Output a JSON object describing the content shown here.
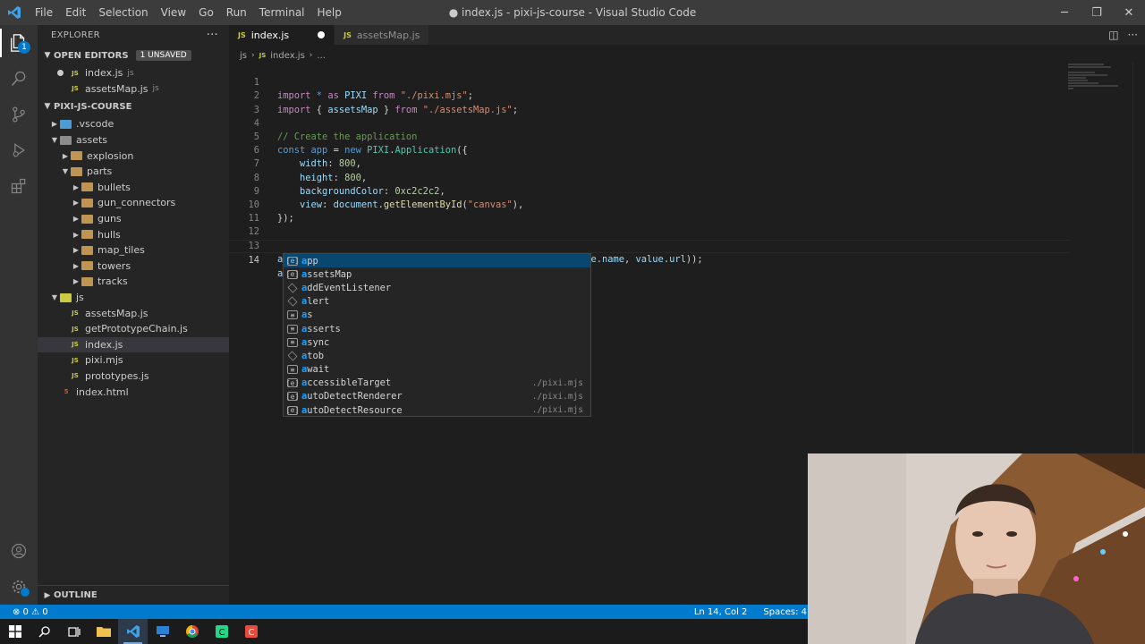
{
  "window": {
    "title": "● index.js - pixi-js-course - Visual Studio Code",
    "menu": [
      "File",
      "Edit",
      "Selection",
      "View",
      "Go",
      "Run",
      "Terminal",
      "Help"
    ]
  },
  "explorer": {
    "header": "EXPLORER",
    "open_editors": {
      "label": "OPEN EDITORS",
      "badge": "1 UNSAVED",
      "files": [
        {
          "name": "index.js",
          "desc": "js"
        },
        {
          "name": "assetsMap.js",
          "desc": "js"
        }
      ]
    },
    "project": {
      "label": "PIXI-JS-COURSE",
      "tree": [
        {
          "name": ".vscode"
        },
        {
          "name": "assets"
        },
        {
          "name": "explosion"
        },
        {
          "name": "parts"
        },
        {
          "name": "bullets"
        },
        {
          "name": "gun_connectors"
        },
        {
          "name": "guns"
        },
        {
          "name": "hulls"
        },
        {
          "name": "map_tiles"
        },
        {
          "name": "towers"
        },
        {
          "name": "tracks"
        },
        {
          "name": "js"
        },
        {
          "name": "assetsMap.js"
        },
        {
          "name": "getPrototypeChain.js"
        },
        {
          "name": "index.js"
        },
        {
          "name": "pixi.mjs"
        },
        {
          "name": "prototypes.js"
        },
        {
          "name": "index.html"
        }
      ]
    },
    "outline": "OUTLINE"
  },
  "tabs": [
    {
      "label": "index.js"
    },
    {
      "label": "assetsMap.js"
    }
  ],
  "breadcrumb": [
    "js",
    "index.js",
    "..."
  ],
  "editor": {
    "line_numbers": [
      "1",
      "2",
      "3",
      "4",
      "5",
      "6",
      "7",
      "8",
      "9",
      "10",
      "11",
      "12",
      "13",
      "14"
    ],
    "lines": {
      "l1": {
        "a": "import",
        "b": " * ",
        "c": "as",
        "d": " PIXI ",
        "e": "from",
        "f": " ",
        "g": "\"./pixi.mjs\"",
        "h": ";"
      },
      "l2": {
        "a": "import",
        "b": " { ",
        "c": "assetsMap",
        "d": " } ",
        "e": "from",
        "f": " ",
        "g": "\"./assetsMap.js\"",
        "h": ";"
      },
      "l4": "// Create the application",
      "l5": {
        "a": "const",
        "b": " ",
        "c": "app",
        "d": " = ",
        "e": "new",
        "f": " ",
        "g": "PIXI",
        "h": ".",
        "i": "Application",
        "j": "({"
      },
      "l6": {
        "k": "width",
        "s": ": ",
        "v": "800",
        "e": ","
      },
      "l7": {
        "k": "height",
        "s": ": ",
        "v": "800",
        "e": ","
      },
      "l8": {
        "k": "backgroundColor",
        "s": ": ",
        "v": "0xc2c2c2",
        "e": ","
      },
      "l9": {
        "k": "view",
        "s": ": ",
        "o": "document",
        "d": ".",
        "f": "getElementById",
        "p": "(",
        "str": "\"canvas\"",
        "e": "),"
      },
      "l10": "});",
      "l13": {
        "a": "assetsMap",
        "b": ".",
        "c": "sprites",
        "d": ".",
        "e": "forEach",
        "f": "((",
        "g": "value",
        "h": ") ",
        "i": "=>",
        "j": " ",
        "k": "app",
        "l": ".",
        "m": "loader",
        "n": ".",
        "o": "add",
        "p": "(",
        "q": "value",
        "r": ".",
        "s": "name",
        "t": ", ",
        "u": "value",
        "v": ".",
        "w": "url",
        "x": "));"
      },
      "l14": "a"
    }
  },
  "suggestions": [
    {
      "rest": "pp",
      "detail": ""
    },
    {
      "rest": "ssetsMap",
      "detail": ""
    },
    {
      "rest": "ddEventListener",
      "detail": ""
    },
    {
      "rest": "lert",
      "detail": ""
    },
    {
      "rest": "s",
      "detail": ""
    },
    {
      "rest": "sserts",
      "detail": ""
    },
    {
      "rest": "sync",
      "detail": ""
    },
    {
      "rest": "tob",
      "detail": ""
    },
    {
      "rest": "wait",
      "detail": ""
    },
    {
      "rest": "ccessibleTarget",
      "detail": "./pixi.mjs"
    },
    {
      "rest": "utoDetectRenderer",
      "detail": "./pixi.mjs"
    },
    {
      "rest": "utoDetectResource",
      "detail": "./pixi.mjs"
    }
  ],
  "suggest_prefix": "a",
  "status": {
    "problems": "⊗ 0 ⚠ 0",
    "position": "Ln 14, Col 2",
    "spaces": "Spaces: 4"
  },
  "colors": {
    "accent": "#007acc",
    "selection": "#094771"
  }
}
